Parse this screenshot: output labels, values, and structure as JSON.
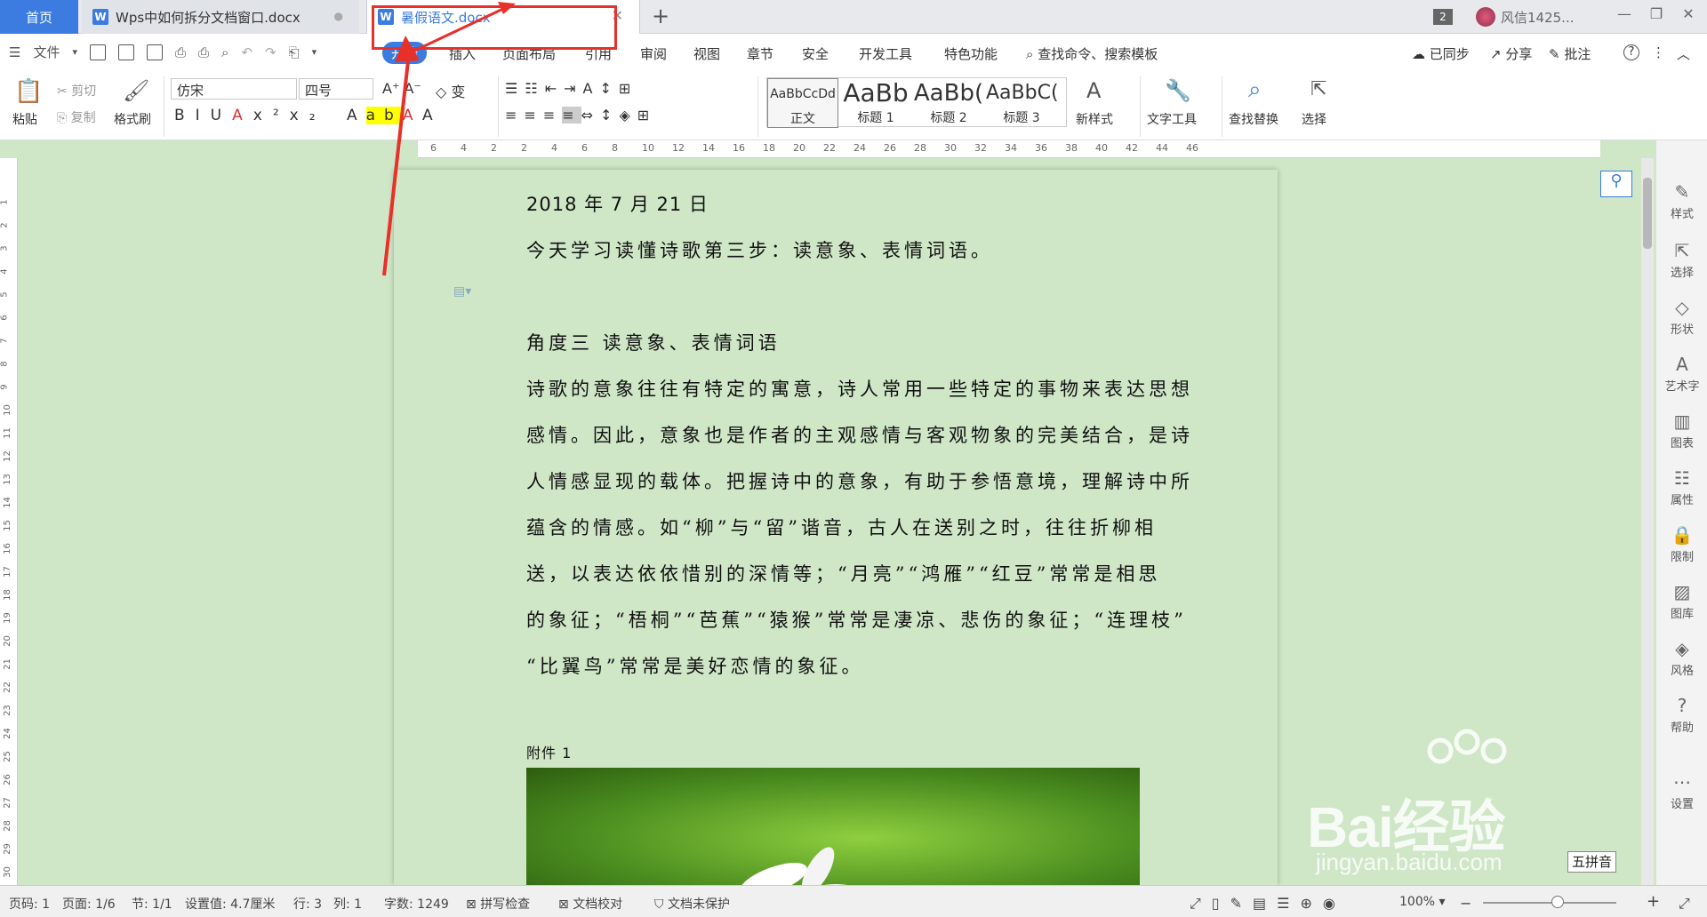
{
  "tabs": {
    "home": "首页",
    "doc1": "Wps中如何拆分文档窗口.docx",
    "doc2": "暑假语文.docx",
    "add": "+",
    "badge": "2",
    "user": "风信1425..."
  },
  "menu": {
    "file": "文件",
    "items": [
      "开始",
      "插入",
      "页面布局",
      "引用",
      "审阅",
      "视图",
      "章节",
      "安全",
      "开发工具",
      "特色功能"
    ],
    "search": "查找命令、搜索模板",
    "sync": "已同步",
    "share": "分享",
    "comment": "批注",
    "help": "?"
  },
  "ribbon": {
    "paste": "粘贴",
    "cut": "剪切",
    "copy": "复制",
    "format_painter": "格式刷",
    "font": "仿宋",
    "size": "四号",
    "styles": [
      {
        "preview": "AaBbCcDd",
        "label": "正文"
      },
      {
        "preview": "AaBb",
        "label": "标题 1"
      },
      {
        "preview": "AaBb(",
        "label": "标题 2"
      },
      {
        "preview": "AaBbC(",
        "label": "标题 3"
      }
    ],
    "new_style": "新样式",
    "text_tools": "文字工具",
    "find_replace": "查找替换",
    "select": "选择"
  },
  "ruler": {
    "h_ticks": [
      "6",
      "4",
      "2",
      "2",
      "4",
      "6",
      "8",
      "10",
      "12",
      "14",
      "16",
      "18",
      "20",
      "22",
      "24",
      "26",
      "28",
      "30",
      "32",
      "34",
      "36",
      "38",
      "40",
      "42",
      "44",
      "46"
    ],
    "v_ticks": [
      "1",
      "2",
      "3",
      "4",
      "5",
      "6",
      "7",
      "8",
      "9",
      "10",
      "11",
      "12",
      "13",
      "14",
      "15",
      "16",
      "17",
      "18",
      "19",
      "20",
      "21",
      "22",
      "23",
      "24",
      "25",
      "26",
      "27",
      "28",
      "29",
      "30"
    ]
  },
  "document": {
    "date": "2018 年 7 月 21 日",
    "line1": "今天学习读懂诗歌第三步：读意象、表情词语。",
    "heading": "角度三   读意象、表情词语",
    "body": [
      "诗歌的意象往往有特定的寓意，诗人常用一些特定的事物来表达思想",
      "感情。因此，意象也是作者的主观感情与客观物象的完美结合，是诗",
      "人情感显现的载体。把握诗中的意象，有助于参悟意境，理解诗中所",
      "蕴含的情感。如“柳”与“留”谐音，古人在送别之时，往往折柳相",
      "送，以表达依依惜别的深情等；“月亮”“鸿雁”“红豆”常常是相思",
      "的象征；“梧桐”“芭蕉”“猿猴”常常是凄凉、悲伤的象征；“连理枝”",
      "“比翼鸟”常常是美好恋情的象征。"
    ],
    "attachment": "附件 1"
  },
  "sidebar": [
    "样式",
    "选择",
    "形状",
    "艺术字",
    "图表",
    "属性",
    "限制",
    "图库",
    "风格",
    "帮助",
    "设置"
  ],
  "status": {
    "page_no": "页码: 1",
    "pages": "页面: 1/6",
    "section": "节: 1/1",
    "setting": "设置值: 4.7厘米",
    "row": "行: 3",
    "col": "列: 1",
    "words": "字数: 1249",
    "spell": "拼写检查",
    "proof": "文档校对",
    "protect": "文档未保护",
    "zoom": "100%"
  },
  "watermark": {
    "brand": "Bai经验",
    "url": "jingyan.baidu.com"
  },
  "ime": "五拼音"
}
